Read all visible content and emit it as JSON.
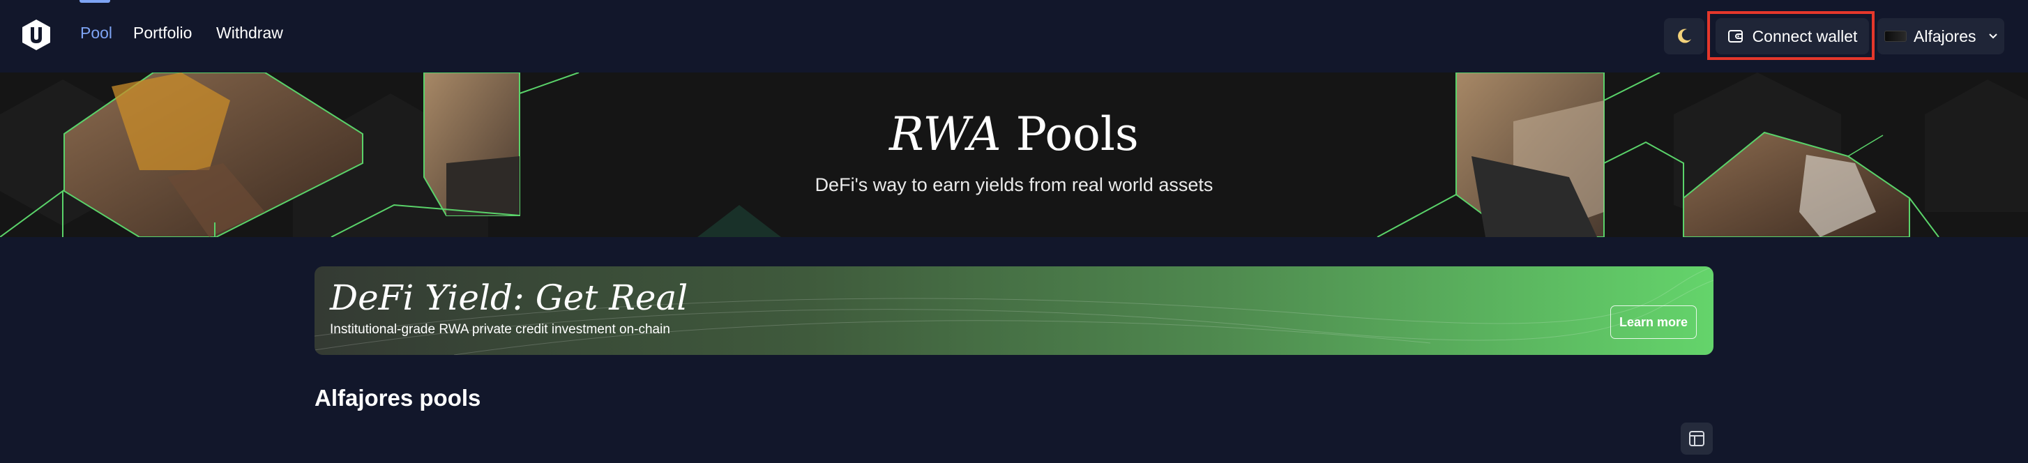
{
  "nav": {
    "links": [
      {
        "label": "Pool",
        "active": true
      },
      {
        "label": "Portfolio",
        "active": false
      },
      {
        "label": "Withdraw",
        "active": false
      }
    ],
    "theme_icon": "moon-icon",
    "wallet_label": "Connect wallet",
    "wallet_icon": "wallet-icon",
    "network_label": "Alfajores",
    "network_icon": "chevron-down-icon",
    "accent_color": "#7ea4f4",
    "highlight_color": "#e5372b"
  },
  "hero": {
    "title_italic": "RWA",
    "title_rest": " Pools",
    "subtitle": "DeFi's way to earn yields from real world assets"
  },
  "promo": {
    "title": "DeFi Yield: Get Real",
    "subtitle": "Institutional-grade RWA private credit investment on-chain",
    "button_label": "Learn more",
    "gradient_end_color": "#64d46b"
  },
  "section": {
    "title": "Alfajores pools",
    "view_toggle_icon": "table-layout-icon"
  }
}
